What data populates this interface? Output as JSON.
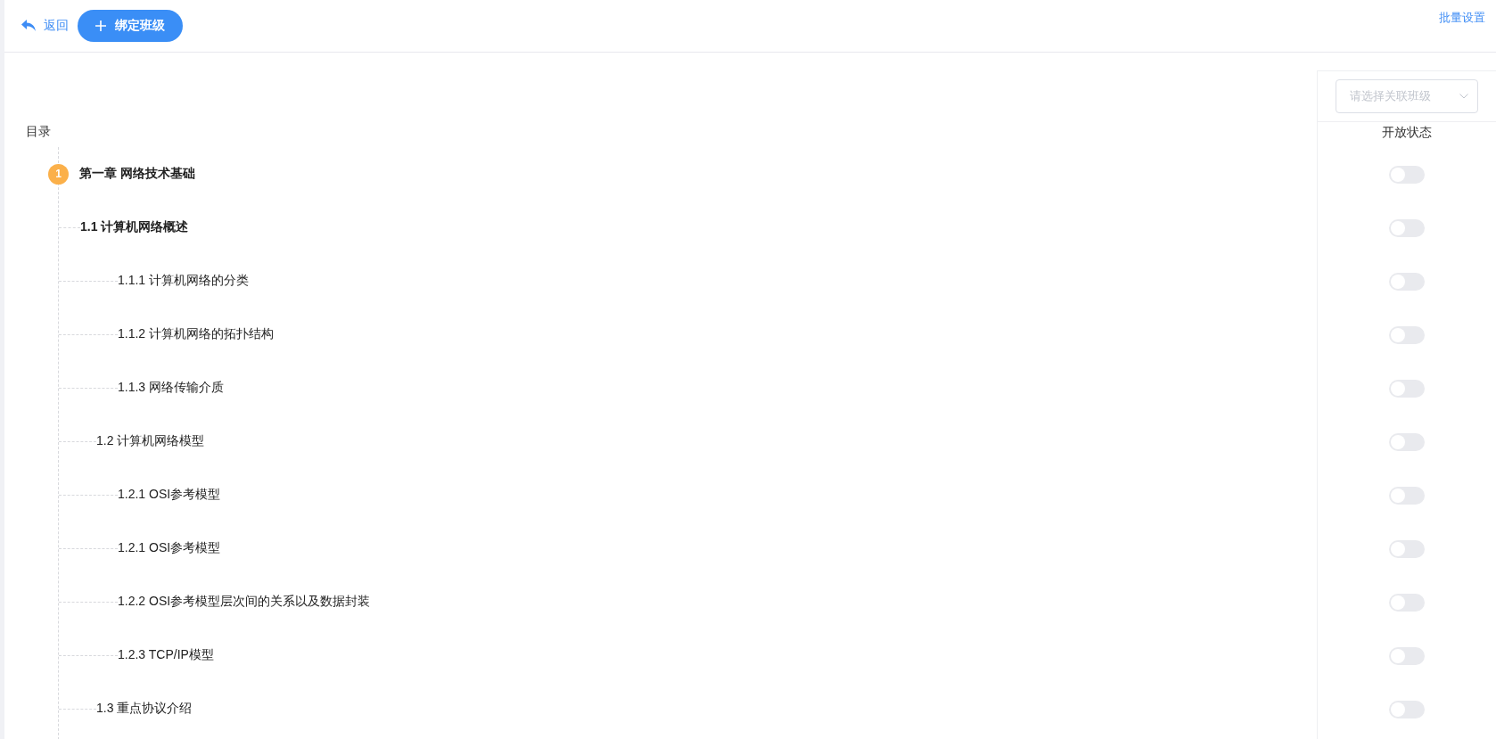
{
  "header": {
    "back_link": "返回",
    "bind_button": "绑定班级",
    "batch_link": "批量设置"
  },
  "class_select": {
    "placeholder": "请选择关联班级"
  },
  "toc": {
    "title": "目录",
    "status_header": "开放状态",
    "items": [
      {
        "kind": "chapter",
        "badge": "1",
        "label": "第一章 网络技术基础",
        "open": false,
        "children": [
          {
            "kind": "section",
            "label": "1.1 计算机网络概述",
            "emphasized": true,
            "open": false,
            "children": [
              {
                "kind": "section",
                "label": "1.1.1 计算机网络的分类",
                "open": false
              },
              {
                "kind": "section",
                "label": "1.1.2 计算机网络的拓扑结构",
                "open": false
              },
              {
                "kind": "section",
                "label": "1.1.3 网络传输介质",
                "open": false
              }
            ]
          },
          {
            "kind": "section",
            "label": "1.2 计算机网络模型",
            "emphasized": false,
            "open": false,
            "children": [
              {
                "kind": "section",
                "label": "1.2.1 OSI参考模型",
                "open": false
              },
              {
                "kind": "section",
                "label": "1.2.1 OSI参考模型",
                "open": false
              },
              {
                "kind": "section",
                "label": "1.2.2 OSI参考模型层次间的关系以及数据封装",
                "open": false
              },
              {
                "kind": "section",
                "label": "1.2.3 TCP/IP模型",
                "open": false
              }
            ]
          },
          {
            "kind": "section",
            "label": "1.3 重点协议介绍",
            "emphasized": false,
            "open": false
          }
        ]
      }
    ]
  }
}
